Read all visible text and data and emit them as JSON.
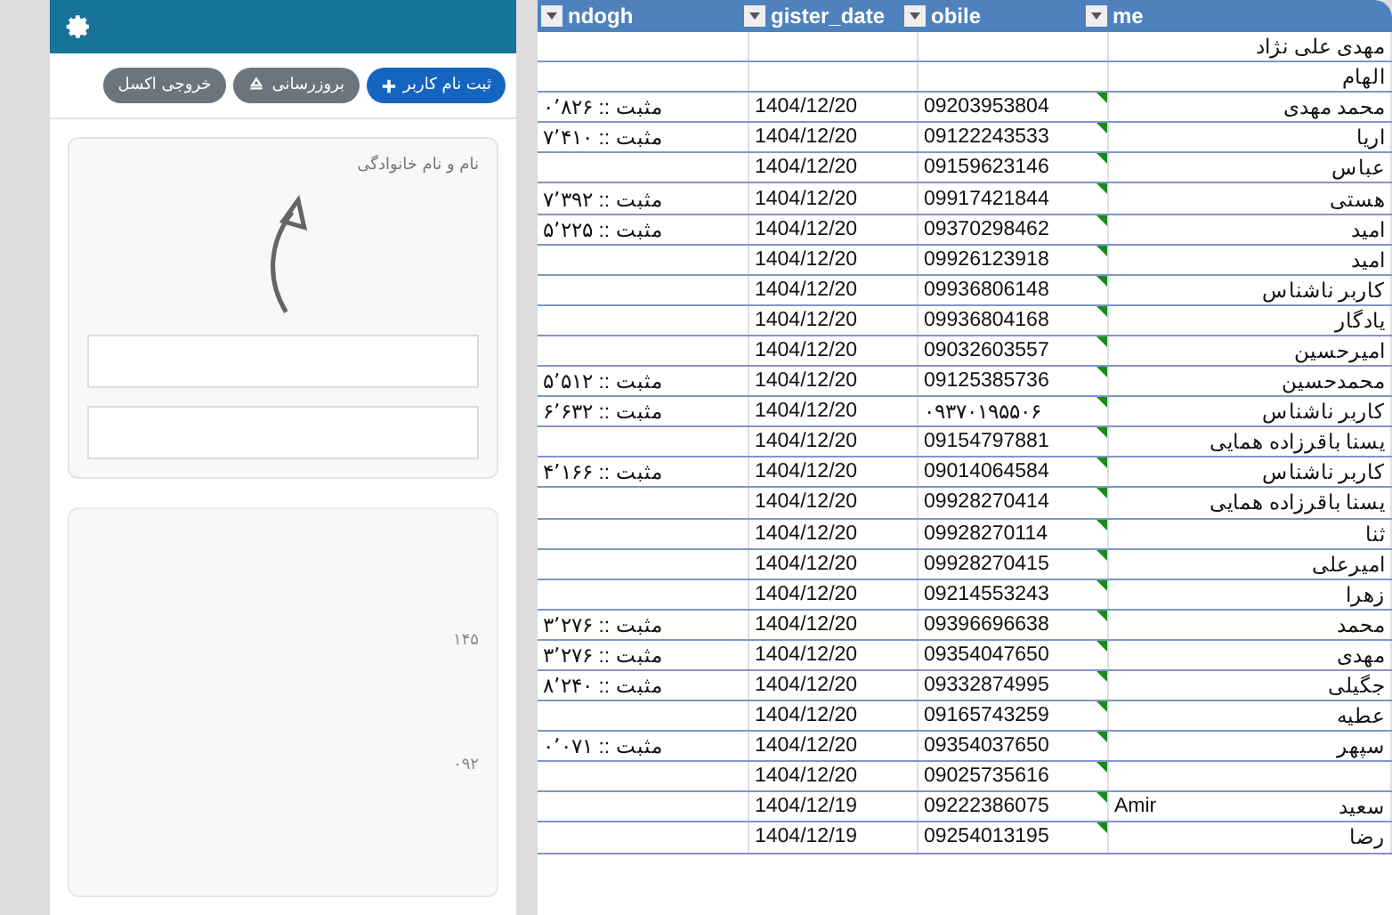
{
  "panel": {
    "buttons": [
      {
        "label": "ثبت نام کاربر",
        "kind": "primary"
      },
      {
        "label": "بروزرسانی",
        "kind": "refresh"
      },
      {
        "label": "خروجی اکسل",
        "kind": "plain"
      }
    ],
    "form_label": "نام و نام خانوادگی",
    "list_fragments": [
      "۱۴۵",
      "۰۹۲"
    ]
  },
  "sheet": {
    "columns": [
      "me",
      "obile",
      "gister_date",
      "ndogh"
    ],
    "rows": [
      {
        "name": "مهدی علی نژاد"
      },
      {
        "name": "الهام"
      },
      {
        "nodogh": "مثبت :: ۰٬۸۲۶",
        "date": "1404/12/20",
        "mobile": "09203953804",
        "flagged": true,
        "name": "محمد مهدی"
      },
      {
        "nodogh": "مثبت :: ۷٬۴۱۰",
        "date": "1404/12/20",
        "mobile": "09122243533",
        "flagged": true,
        "name": "اریا"
      },
      {
        "date": "1404/12/20",
        "mobile": "09159623146",
        "flagged": true,
        "name": "عباس"
      },
      {
        "nodogh": "مثبت :: ۷٬۳۹۲",
        "date": "1404/12/20",
        "mobile": "09917421844",
        "flagged": true,
        "name": "هستی"
      },
      {
        "nodogh": "مثبت :: ۵٬۲۲۵",
        "date": "1404/12/20",
        "mobile": "09370298462",
        "flagged": true,
        "name": "امید"
      },
      {
        "date": "1404/12/20",
        "mobile": "09926123918",
        "flagged": true,
        "name": "امید"
      },
      {
        "date": "1404/12/20",
        "mobile": "09936806148",
        "flagged": true,
        "name": "کاربر ناشناس"
      },
      {
        "date": "1404/12/20",
        "mobile": "09936804168",
        "flagged": true,
        "name": "یادگار"
      },
      {
        "date": "1404/12/20",
        "mobile": "09032603557",
        "flagged": true,
        "name": "امیرحسین"
      },
      {
        "nodogh": "مثبت :: ۵٬۵۱۲",
        "date": "1404/12/20",
        "mobile": "09125385736",
        "flagged": true,
        "name": "محمدحسین"
      },
      {
        "nodogh": "مثبت :: ۶٬۶۳۲",
        "date": "1404/12/20",
        "mobile": "۰۹۳۷۰۱۹۵۵۰۶",
        "flagged": true,
        "name": "کاربر ناشناس"
      },
      {
        "date": "1404/12/20",
        "mobile": "09154797881",
        "flagged": true,
        "name": "یسنا باقرزاده همایی"
      },
      {
        "nodogh": "مثبت :: ۴٬۱۶۶",
        "date": "1404/12/20",
        "mobile": "09014064584",
        "flagged": true,
        "name": "کاربر ناشناس"
      },
      {
        "date": "1404/12/20",
        "mobile": "09928270414",
        "flagged": true,
        "name": "یسنا باقرزاده همایی"
      },
      {
        "date": "1404/12/20",
        "mobile": "09928270114",
        "flagged": true,
        "name": "ثنا"
      },
      {
        "date": "1404/12/20",
        "mobile": "09928270415",
        "flagged": true,
        "name": "امیرعلی"
      },
      {
        "date": "1404/12/20",
        "mobile": "09214553243",
        "flagged": true,
        "name": "زهرا"
      },
      {
        "nodogh": "مثبت :: ۳٬۲۷۶",
        "date": "1404/12/20",
        "mobile": "09396696638",
        "flagged": true,
        "name": "محمد"
      },
      {
        "nodogh": "مثبت :: ۳٬۲۷۶",
        "date": "1404/12/20",
        "mobile": "09354047650",
        "flagged": true,
        "name": "مهدی"
      },
      {
        "nodogh": "مثبت :: ۸٬۲۴۰",
        "date": "1404/12/20",
        "mobile": "09332874995",
        "flagged": true,
        "name": "جگیلی"
      },
      {
        "date": "1404/12/20",
        "mobile": "09165743259",
        "flagged": true,
        "name": "عطیه"
      },
      {
        "nodogh": "مثبت :: ۰٬۰۷۱",
        "date": "1404/12/20",
        "mobile": "09354037650",
        "flagged": true,
        "name": "سپهر"
      },
      {
        "date": "1404/12/20",
        "mobile": "09025735616",
        "flagged": true
      },
      {
        "date": "1404/12/19",
        "mobile": "09222386075",
        "flagged": true,
        "alias": "Amir",
        "name": "سعید"
      },
      {
        "date": "1404/12/19",
        "mobile": "09254013195",
        "flagged": true,
        "name": "رضا"
      }
    ]
  }
}
